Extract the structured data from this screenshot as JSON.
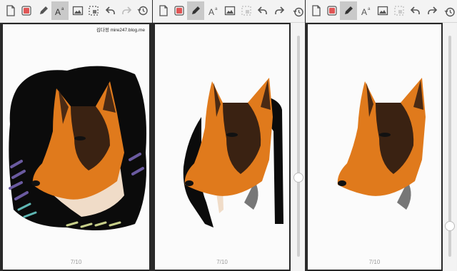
{
  "app": {
    "toolbar_icons": [
      "new-page-icon",
      "eraser-icon",
      "pen-icon",
      "text-icon",
      "image-icon",
      "selection-icon",
      "undo-icon",
      "redo-icon",
      "history-icon"
    ]
  },
  "panels": [
    {
      "credit": "김다정  mire247.blog.me",
      "page_indicator": "7/10",
      "active_tool": "text-icon"
    },
    {
      "page_indicator": "7/10",
      "active_tool": "pen-icon",
      "slider_fraction": 0.64
    },
    {
      "page_indicator": "7/10",
      "active_tool": "pen-icon",
      "slider_fraction": 0.95
    }
  ],
  "colors": {
    "eraser_red": "#e05656",
    "icon_gray": "#555555",
    "fur_orange": "#e07a1c",
    "fur_dark": "#3a2212"
  }
}
